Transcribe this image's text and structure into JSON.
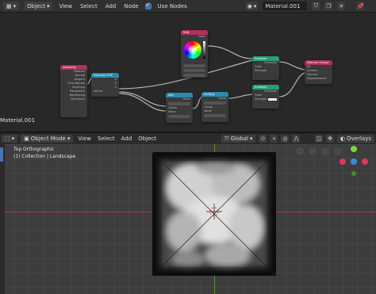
{
  "node_editor": {
    "header": {
      "editor_type": "Object",
      "menus": [
        "View",
        "Select",
        "Add",
        "Node"
      ],
      "use_nodes_label": "Use Nodes",
      "material_name": "Material.001"
    },
    "material_label": "Material.001",
    "nodes": {
      "geometry": {
        "title": "Geometry",
        "rows": [
          "Position",
          "Normal",
          "Tangent",
          "True Normal",
          "Incoming",
          "Parametric",
          "Backfacing",
          "Pointiness"
        ]
      },
      "separate": {
        "title": "Separate XYZ",
        "rows": [
          "X",
          "Y",
          "Z",
          "Vector"
        ]
      },
      "rgb": {
        "title": "RGB",
        "rows": [
          "Color"
        ]
      },
      "add1": {
        "title": "Add",
        "rows": [
          "Value",
          "Clamp",
          "Value",
          "Value"
        ]
      },
      "add2": {
        "title": "Multiply",
        "rows": [
          "Value",
          "Clamp",
          "Value",
          "Value"
        ]
      },
      "emission1": {
        "title": "Emission",
        "rows": [
          "Emission",
          "Color",
          "Strength"
        ]
      },
      "emission2": {
        "title": "Emission",
        "rows": [
          "Emission",
          "Color",
          "Strength"
        ]
      },
      "output": {
        "title": "Material Output",
        "rows": [
          "All",
          "Surface",
          "Volume",
          "Displacement"
        ]
      }
    }
  },
  "viewport": {
    "header": {
      "mode": "Object Mode",
      "menus": [
        "View",
        "Select",
        "Add",
        "Object"
      ],
      "transform": "Global",
      "overlays_label": "Overlays"
    },
    "view_name": "Top Orthographic",
    "collection_info": "(1) Collection | Landscape"
  },
  "colors": {
    "accent": "#4772b3",
    "x_axis": "#e0365e",
    "y_axis": "#7bd43a",
    "z_axis": "#3a8ce0"
  }
}
